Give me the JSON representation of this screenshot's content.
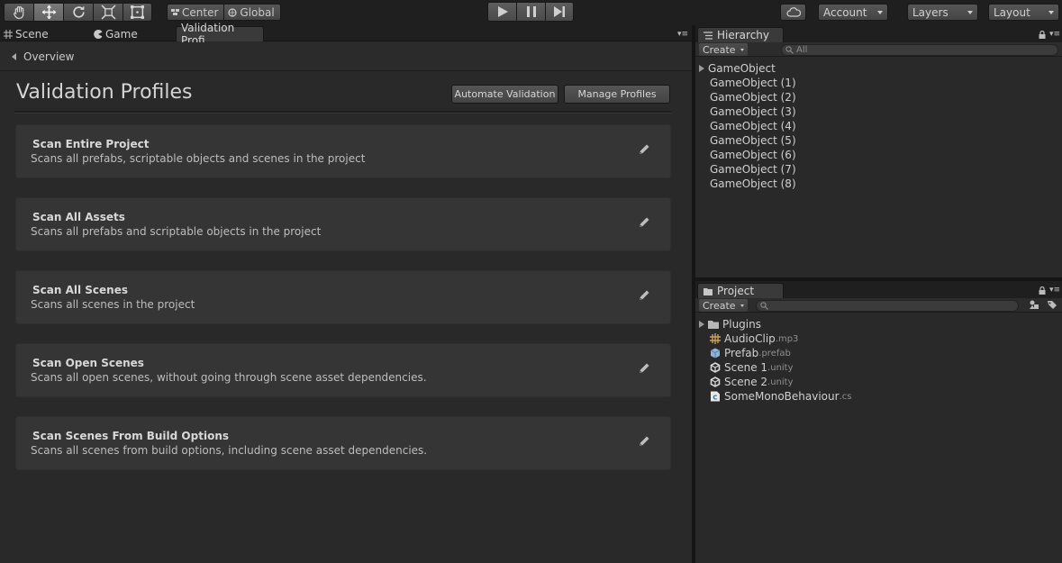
{
  "toolbar": {
    "tools": [
      "hand-tool",
      "move-tool",
      "rotate-tool",
      "scale-tool",
      "rect-tool"
    ],
    "pivot": {
      "center_label": "Center",
      "global_label": "Global"
    },
    "account_label": "Account",
    "layers_label": "Layers",
    "layout_label": "Layout"
  },
  "main_tabs": {
    "scene": "Scene",
    "game": "Game",
    "validation": "Validation Profi"
  },
  "overview": {
    "label": "Overview"
  },
  "header": {
    "title": "Validation Profiles",
    "automate_label": "Automate Validation",
    "manage_label": "Manage Profiles"
  },
  "profiles": [
    {
      "name": "Scan Entire Project",
      "description": "Scans all prefabs, scriptable objects and scenes in the project"
    },
    {
      "name": "Scan All Assets",
      "description": "Scans all prefabs and scriptable objects in the project"
    },
    {
      "name": "Scan All Scenes",
      "description": "Scans all scenes in the project"
    },
    {
      "name": "Scan Open Scenes",
      "description": "Scans all open scenes, without going through scene asset dependencies."
    },
    {
      "name": "Scan Scenes From Build Options",
      "description": "Scans all scenes from build options, including scene asset dependencies."
    }
  ],
  "hierarchy": {
    "tab_label": "Hierarchy",
    "create_label": "Create",
    "search_placeholder": "All",
    "items": [
      "GameObject",
      "GameObject (1)",
      "GameObject (2)",
      "GameObject (3)",
      "GameObject (4)",
      "GameObject (5)",
      "GameObject (6)",
      "GameObject (7)",
      "GameObject (8)"
    ]
  },
  "project": {
    "tab_label": "Project",
    "create_label": "Create",
    "items": [
      {
        "name": "Plugins",
        "ext": "",
        "icon": "folder-icon"
      },
      {
        "name": "AudioClip",
        "ext": ".mp3",
        "icon": "audio-icon"
      },
      {
        "name": "Prefab",
        "ext": ".prefab",
        "icon": "prefab-icon"
      },
      {
        "name": "Scene 1",
        "ext": ".unity",
        "icon": "unity-scene-icon"
      },
      {
        "name": "Scene 2",
        "ext": ".unity",
        "icon": "unity-scene-icon"
      },
      {
        "name": "SomeMonoBehaviour",
        "ext": ".cs",
        "icon": "csharp-script-icon"
      }
    ]
  }
}
